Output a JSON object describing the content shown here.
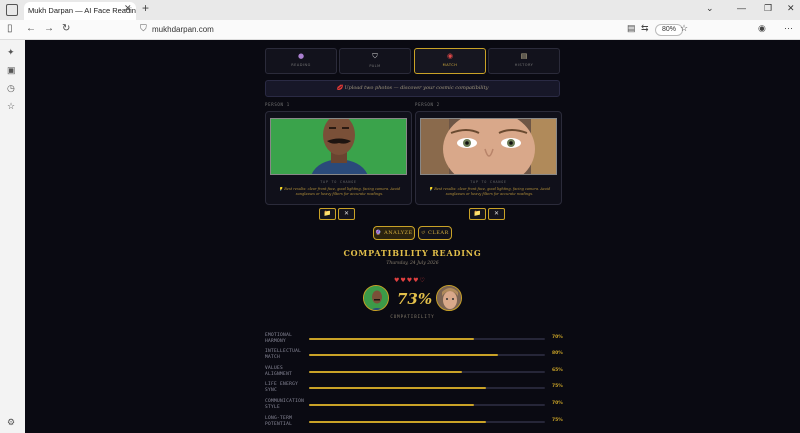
{
  "browser": {
    "tab_title": "Mukh Darpan — AI Face Reading | ",
    "url": "mukhdarpan.com",
    "zoom": "80%"
  },
  "modes": [
    {
      "label": "READING",
      "icon": "crystal-ball-icon"
    },
    {
      "label": "PALM",
      "icon": "shield-icon"
    },
    {
      "label": "MATCH",
      "icon": "lips-icon"
    },
    {
      "label": "HISTORY",
      "icon": "scroll-icon"
    }
  ],
  "active_mode": "MATCH",
  "instruction": "💋 Upload two photos — discover your cosmic compatibility",
  "person1": {
    "label": "PERSON 1",
    "caption": "TAP TO CHANGE",
    "tip": "💡 Best results: clear front face, good lighting, facing camera. Avoid sunglasses or heavy filters for accurate readings."
  },
  "person2": {
    "label": "PERSON 2",
    "caption": "TAP TO CHANGE",
    "tip": "💡 Best results: clear front face, good lighting, facing camera. Avoid sunglasses or heavy filters for accurate readings."
  },
  "buttons": {
    "analyze": "🔮 ANALYZE",
    "clear": "↺ CLEAR",
    "upload_glyph": "📁",
    "remove_glyph": "✕"
  },
  "result": {
    "heading": "COMPATIBILITY READING",
    "date": "Thursday, 24 July 2026",
    "hearts": "♥♥♥♥♡",
    "score": "73%",
    "score_label": "COMPATIBILITY"
  },
  "traits": [
    {
      "label": "EMOTIONAL HARMONY",
      "value": 70,
      "display": "70%"
    },
    {
      "label": "INTELLECTUAL MATCH",
      "value": 80,
      "display": "80%"
    },
    {
      "label": "VALUES ALIGNMENT",
      "value": 65,
      "display": "65%"
    },
    {
      "label": "LIFE ENERGY SYNC",
      "value": 75,
      "display": "75%"
    },
    {
      "label": "COMMUNICATION STYLE",
      "value": 70,
      "display": "70%"
    },
    {
      "label": "LONG-TERM POTENTIAL",
      "value": 75,
      "display": "75%"
    }
  ],
  "colors": {
    "background": "#0a0a12",
    "gold": "#c9a227",
    "heading_gold": "#e2bf4a",
    "track": "#262638"
  }
}
